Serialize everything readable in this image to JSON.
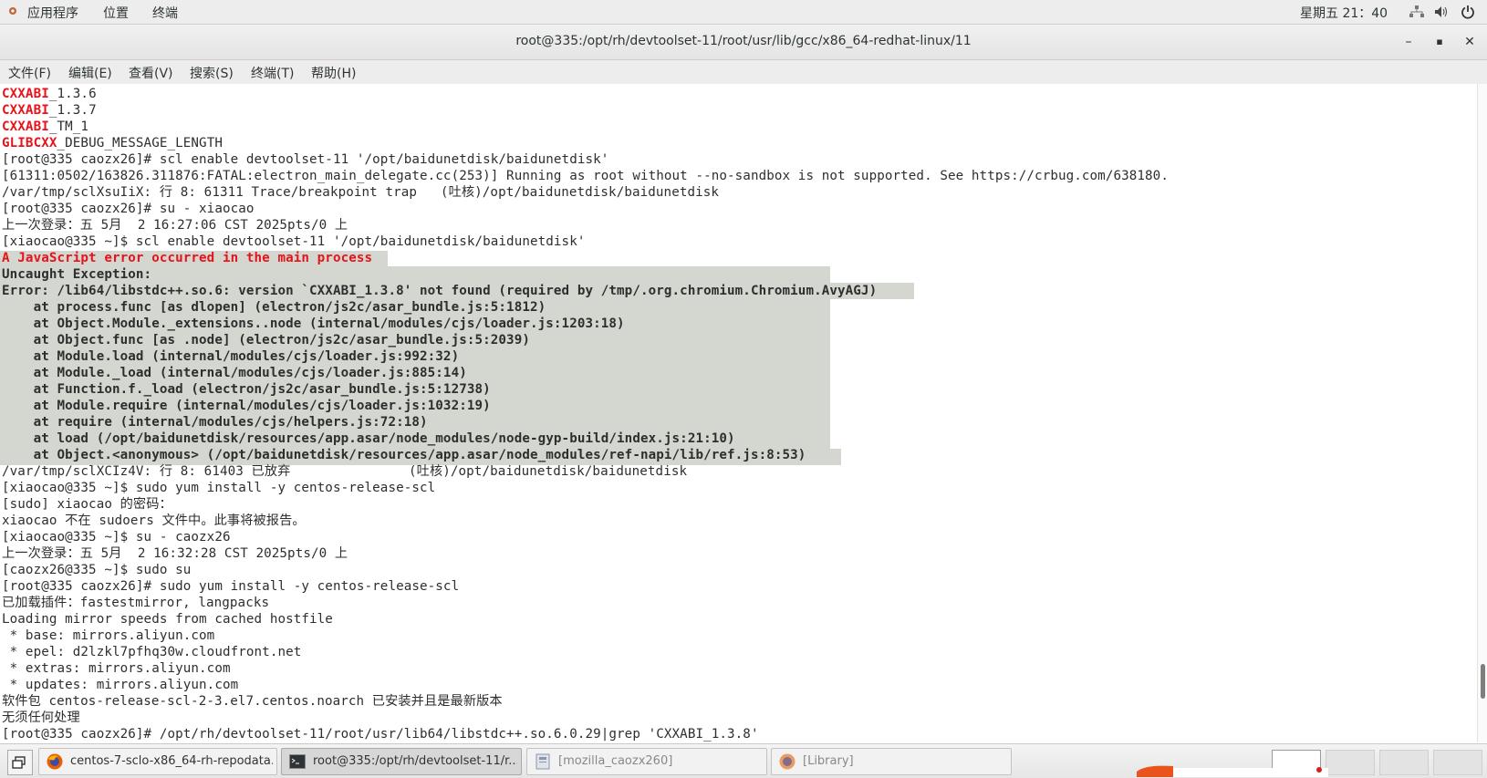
{
  "topbar": {
    "apps": "应用程序",
    "places": "位置",
    "terminal": "终端",
    "clock": "星期五 21：40"
  },
  "window": {
    "title": "root@335:/opt/rh/devtoolset-11/root/usr/lib/gcc/x86_64-redhat-linux/11",
    "minimize": "–",
    "maximize": "▪",
    "close": "✕"
  },
  "menubar": {
    "file": "文件(F)",
    "edit": "编辑(E)",
    "view": "查看(V)",
    "search": "搜索(S)",
    "terminal": "终端(T)",
    "help": "帮助(H)"
  },
  "terminal": {
    "lines": [
      {
        "a": "CXXABI",
        "b": "_1.3.6"
      },
      {
        "a": "CXXABI",
        "b": "_1.3.7"
      },
      {
        "a": "CXXABI",
        "b": "_TM_1"
      },
      {
        "a": "GLIBCXX",
        "b": "_DEBUG_MESSAGE_LENGTH"
      },
      {
        "t": "[root@335 caozx26]# scl enable devtoolset-11 '/opt/baidunetdisk/baidunetdisk'"
      },
      {
        "t": "[61311:0502/163826.311876:FATAL:electron_main_delegate.cc(253)] Running as root without --no-sandbox is not supported. See https://crbug.com/638180."
      },
      {
        "t": "/var/tmp/sclXsuIiX: 行 8: 61311 Trace/breakpoint trap   (吐核)/opt/baidunetdisk/baidunetdisk"
      },
      {
        "t": "[root@335 caozx26]# su - xiaocao"
      },
      {
        "t": "上一次登录：五 5月  2 16:27:06 CST 2025pts/0 上"
      },
      {
        "t": "[xiaocao@335 ~]$ scl enable devtoolset-11 '/opt/baidunetdisk/baidunetdisk'"
      },
      {
        "t": "A JavaScript error occurred in the main process"
      },
      {
        "t": "Uncaught Exception:"
      },
      {
        "t": "Error: /lib64/libstdc++.so.6: version `CXXABI_1.3.8' not found (required by /tmp/.org.chromium.Chromium.AvyAGJ)"
      },
      {
        "t": "    at process.func [as dlopen] (electron/js2c/asar_bundle.js:5:1812)"
      },
      {
        "t": "    at Object.Module._extensions..node (internal/modules/cjs/loader.js:1203:18)"
      },
      {
        "t": "    at Object.func [as .node] (electron/js2c/asar_bundle.js:5:2039)"
      },
      {
        "t": "    at Module.load (internal/modules/cjs/loader.js:992:32)"
      },
      {
        "t": "    at Module._load (internal/modules/cjs/loader.js:885:14)"
      },
      {
        "t": "    at Function.f._load (electron/js2c/asar_bundle.js:5:12738)"
      },
      {
        "t": "    at Module.require (internal/modules/cjs/loader.js:1032:19)"
      },
      {
        "t": "    at require (internal/modules/cjs/helpers.js:72:18)"
      },
      {
        "t": "    at load (/opt/baidunetdisk/resources/app.asar/node_modules/node-gyp-build/index.js:21:10)"
      },
      {
        "t": "    at Object.<anonymous> (/opt/baidunetdisk/resources/app.asar/node_modules/ref-napi/lib/ref.js:8:53)"
      },
      {
        "t": "/var/tmp/sclXCIz4V: 行 8: 61403 已放弃               (吐核)/opt/baidunetdisk/baidunetdisk"
      },
      {
        "t": "[xiaocao@335 ~]$ sudo yum install -y centos-release-scl"
      },
      {
        "t": "[sudo] xiaocao 的密码："
      },
      {
        "t": "xiaocao 不在 sudoers 文件中。此事将被报告。"
      },
      {
        "t": "[xiaocao@335 ~]$ su - caozx26"
      },
      {
        "t": "上一次登录：五 5月  2 16:32:28 CST 2025pts/0 上"
      },
      {
        "t": "[caozx26@335 ~]$ sudo su"
      },
      {
        "t": "[root@335 caozx26]# sudo yum install -y centos-release-scl"
      },
      {
        "t": "已加载插件：fastestmirror, langpacks"
      },
      {
        "t": "Loading mirror speeds from cached hostfile"
      },
      {
        "t": " * base: mirrors.aliyun.com"
      },
      {
        "t": " * epel: d2lzkl7pfhq30w.cloudfront.net"
      },
      {
        "t": " * extras: mirrors.aliyun.com"
      },
      {
        "t": " * updates: mirrors.aliyun.com"
      },
      {
        "t": "软件包 centos-release-scl-2-3.el7.centos.noarch 已安装并且是最新版本"
      },
      {
        "t": "无须任何处理"
      },
      {
        "t": "[root@335 caozx26]# /opt/rh/devtoolset-11/root/usr/lib64/libstdc++.so.6.0.29|grep 'CXXABI_1.3.8'"
      }
    ]
  },
  "taskbar": {
    "tasks": [
      "centos-7-sclo-x86_64-rh-repodata...",
      "root@335:/opt/rh/devtoolset-11/r...",
      "[mozilla_caozx260]",
      "[Library]"
    ]
  }
}
